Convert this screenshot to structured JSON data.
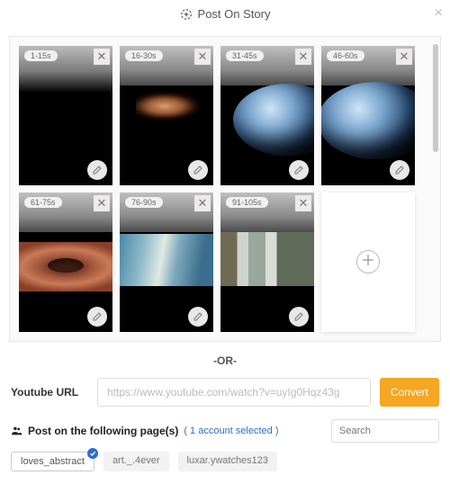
{
  "header": {
    "title": "Post On Story"
  },
  "clips": [
    {
      "badge": "1-15s"
    },
    {
      "badge": "16-30s"
    },
    {
      "badge": "31-45s"
    },
    {
      "badge": "46-60s"
    },
    {
      "badge": "61-75s"
    },
    {
      "badge": "76-90s"
    },
    {
      "badge": "91-105s"
    }
  ],
  "separator": "-OR-",
  "youtube": {
    "label": "Youtube URL",
    "placeholder": "https://www.youtube.com/watch?v=uyIg0Hqz43g",
    "convert": "Convert"
  },
  "pages": {
    "lead": "Post on the following page(s)",
    "selected_note": "( 1 account selected )",
    "search_placeholder": "Search"
  },
  "accounts": [
    {
      "name": "loves_abstract",
      "selected": true
    },
    {
      "name": "art._.4ever",
      "selected": false
    },
    {
      "name": "luxar.ywatches123",
      "selected": false
    }
  ]
}
